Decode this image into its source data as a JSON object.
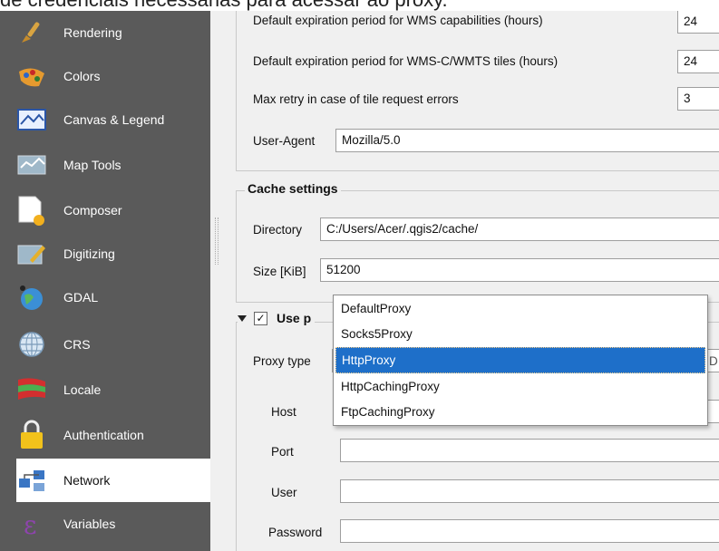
{
  "caption": "de credenciais necessárias para acessar ao proxy.",
  "sidebar": {
    "items": [
      {
        "label": "Rendering",
        "icon": "paintbrush-icon"
      },
      {
        "label": "Colors",
        "icon": "color-palette-icon"
      },
      {
        "label": "Canvas & Legend",
        "icon": "canvas-legend-icon"
      },
      {
        "label": "Map Tools",
        "icon": "map-tools-icon"
      },
      {
        "label": "Composer",
        "icon": "composer-icon"
      },
      {
        "label": "Digitizing",
        "icon": "digitizing-icon"
      },
      {
        "label": "GDAL",
        "icon": "gdal-globe-icon"
      },
      {
        "label": "CRS",
        "icon": "crs-globe-icon"
      },
      {
        "label": "Locale",
        "icon": "locale-flag-icon"
      },
      {
        "label": "Authentication",
        "icon": "padlock-icon"
      },
      {
        "label": "Network",
        "icon": "network-icon",
        "selected": true
      },
      {
        "label": "Variables",
        "icon": "variables-icon"
      }
    ]
  },
  "wms": {
    "capabilities_label": "Default expiration period for WMS capabilities (hours)",
    "capabilities_value": "24",
    "tiles_label": "Default expiration period for WMS-C/WMTS tiles (hours)",
    "tiles_value": "24",
    "retry_label": "Max retry in case of tile request errors",
    "retry_value": "3",
    "user_agent_label": "User-Agent",
    "user_agent_value": "Mozilla/5.0"
  },
  "cache": {
    "title": "Cache settings",
    "directory_label": "Directory",
    "directory_value": "C:/Users/Acer/.qgis2/cache/",
    "size_label": "Size [KiB]",
    "size_value": "51200"
  },
  "proxy": {
    "title_visible": "Use p",
    "checked": true,
    "type_label": "Proxy type",
    "host_label": "Host",
    "port_label": "Port",
    "user_label": "User",
    "password_label": "Password",
    "options": [
      "DefaultProxy",
      "Socks5Proxy",
      "HttpProxy",
      "HttpCachingProxy",
      "FtpCachingProxy"
    ],
    "selected_option": "HttpProxy"
  }
}
